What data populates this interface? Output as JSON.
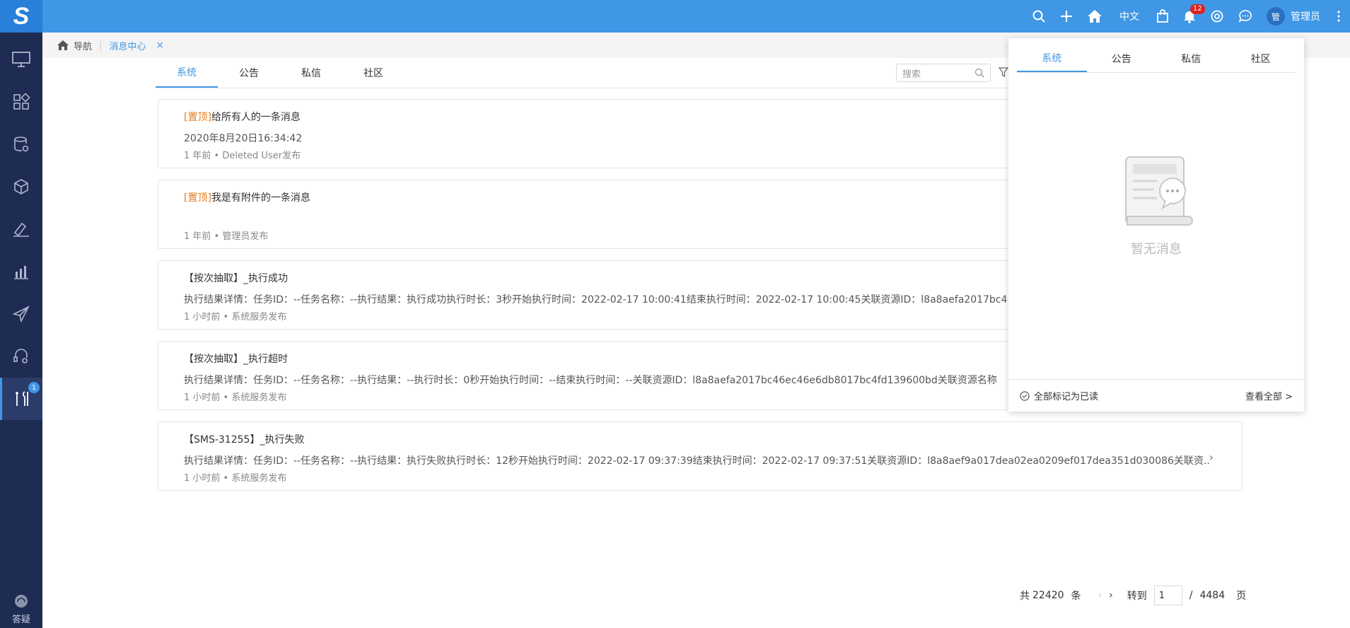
{
  "header": {
    "logo_letter": "S",
    "lang": "中文",
    "notification_count": "12",
    "avatar_text": "管",
    "user": "管理员",
    "accent": "#3f97e6"
  },
  "sidebar": {
    "badge": "1",
    "footer": "答疑",
    "icons": [
      "monitor-icon",
      "apps-icon",
      "database-icon",
      "cube-icon",
      "pen-icon",
      "bar-chart-icon",
      "send-icon",
      "service-icon",
      "tools-icon"
    ]
  },
  "breadcrumb": {
    "home": "导航",
    "active": "消息中心",
    "close": "×"
  },
  "tabs": [
    "系统",
    "公告",
    "私信",
    "社区"
  ],
  "search": {
    "placeholder": "搜索"
  },
  "messages": [
    {
      "pin": "[置顶]",
      "title": "给所有人的一条消息",
      "detail": "2020年8月20日16:34:42",
      "meta": "1 年前 • Deleted User发布"
    },
    {
      "pin": "[置顶]",
      "title": "我是有附件的一条消息",
      "detail": "",
      "meta": "1 年前 • 管理员发布"
    },
    {
      "pin": "",
      "title": "【按次抽取】_执行成功",
      "detail": "执行结果详情：任务ID：--任务名称：--执行结果：执行成功执行时长：3秒开始执行时间：2022-02-17 10:00:41结束执行时间：2022-02-17 10:00:45关联资源ID：l8a8aefa2017bc4",
      "meta": "1 小时前 • 系统服务发布"
    },
    {
      "pin": "",
      "title": "【按次抽取】_执行超时",
      "detail": "执行结果详情：任务ID：--任务名称：--执行结果：--执行时长：0秒开始执行时间：--结束执行时间：--关联资源ID：l8a8aefa2017bc46ec46e6db8017bc4fd139600bd关联资源名称",
      "meta": "1 小时前 • 系统服务发布"
    },
    {
      "pin": "",
      "title": "【SMS-31255】_执行失败",
      "detail": "执行结果详情：任务ID：--任务名称：--执行结果：执行失败执行时长：12秒开始执行时间：2022-02-17 09:37:39结束执行时间：2022-02-17 09:37:51关联资源ID：l8a8aef9a017dea02ea0209ef017dea351d030086关联资...",
      "meta": "1 小时前 • 系统服务发布"
    }
  ],
  "pager": {
    "total_prefix": "共",
    "total": "22420",
    "total_suffix": "条",
    "goto": "转到",
    "page": "1",
    "sep": "/",
    "pages": "4484",
    "pages_suffix": "页"
  },
  "popup": {
    "tabs": [
      "系统",
      "公告",
      "私信",
      "社区"
    ],
    "empty": "暂无消息",
    "mark_all": "全部标记为已读",
    "view_all": "查看全部 >"
  }
}
